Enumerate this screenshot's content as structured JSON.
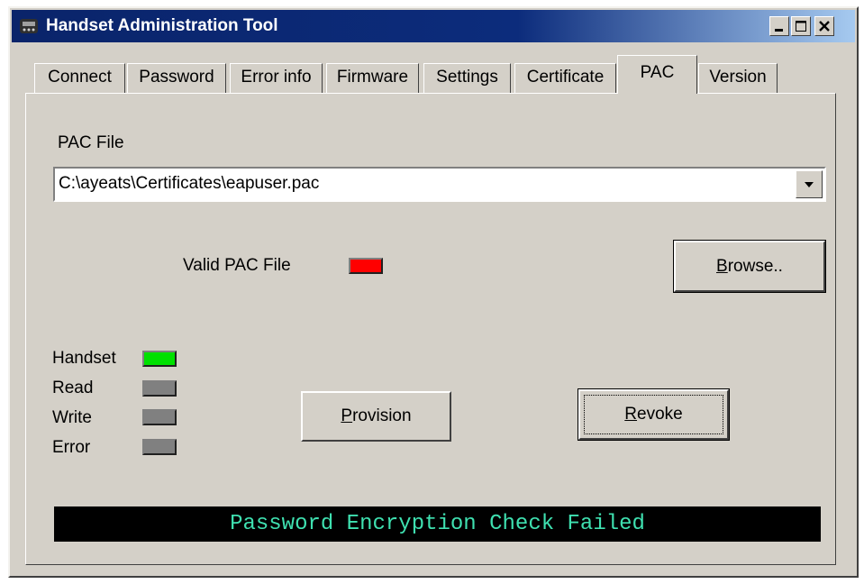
{
  "window": {
    "title": "Handset Administration Tool",
    "controls": [
      "minimize-icon",
      "maximize-icon",
      "close-icon"
    ]
  },
  "tabs": [
    {
      "label": "Connect",
      "active": false
    },
    {
      "label": "Password",
      "active": false
    },
    {
      "label": "Error info",
      "active": false
    },
    {
      "label": "Firmware",
      "active": false
    },
    {
      "label": "Settings",
      "active": false
    },
    {
      "label": "Certificate",
      "active": false
    },
    {
      "label": "PAC",
      "active": true
    },
    {
      "label": "Version",
      "active": false
    }
  ],
  "pac": {
    "file_label": "PAC File",
    "file_value": "C:\\ayeats\\Certificates\\eapuser.pac",
    "valid_label": "Valid PAC File",
    "valid_color": "#ff0000"
  },
  "buttons": {
    "browse_prefix": "B",
    "browse_rest": "rowse..",
    "provision_prefix": "P",
    "provision_rest": "rovision",
    "revoke_prefix": "R",
    "revoke_rest": "evoke"
  },
  "indicators": [
    {
      "label": "Handset",
      "color": "#00e000"
    },
    {
      "label": "Read",
      "color": "#808080"
    },
    {
      "label": "Write",
      "color": "#808080"
    },
    {
      "label": "Error",
      "color": "#808080"
    }
  ],
  "status": {
    "message": "Password Encryption Check Failed",
    "text_color": "#3fe0b0",
    "background": "#000000"
  }
}
